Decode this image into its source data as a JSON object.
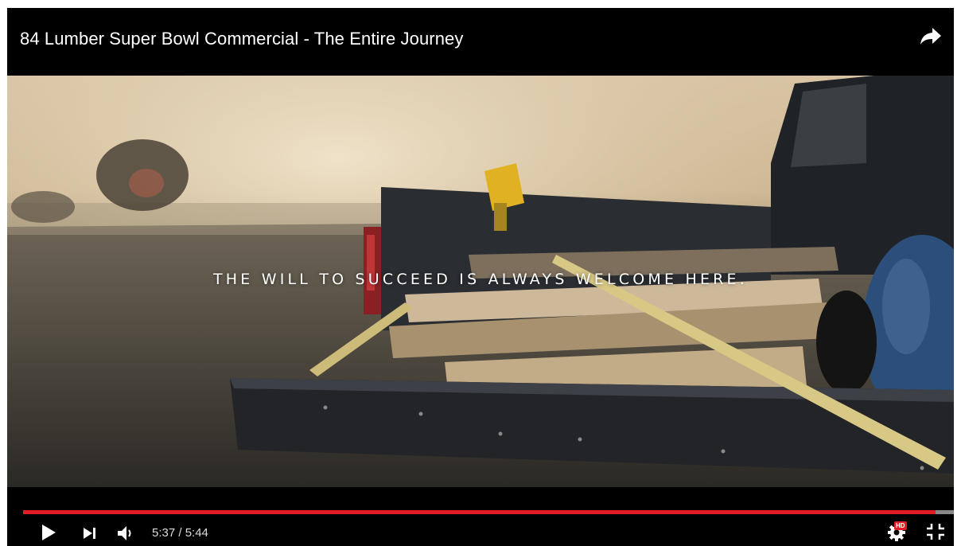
{
  "video": {
    "title": "84 Lumber Super Bowl Commercial - The Entire Journey",
    "subtitle_text": "THE WILL TO SUCCEED IS ALWAYS WELCOME HERE."
  },
  "controls": {
    "play_icon": "play-icon",
    "next_icon": "next-icon",
    "volume_icon": "volume-icon",
    "time_display": "5:37 / 5:44",
    "progress_fraction": 0.98,
    "hd_badge": "HD",
    "settings_icon": "gear-icon",
    "exit_fullscreen_icon": "exit-fullscreen-icon",
    "share_icon": "share-arrow-icon"
  },
  "colors": {
    "progress": "#e21c24",
    "background": "#000000"
  }
}
